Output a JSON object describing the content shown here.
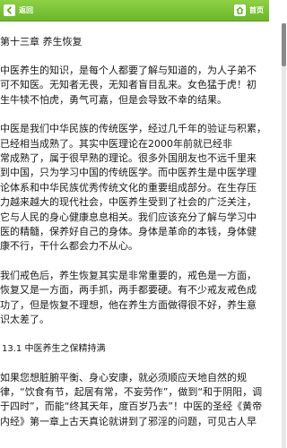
{
  "toolbar": {
    "back_label": "返回",
    "home_label": "首页",
    "back_icon": "back-arrow-icon",
    "home_icon": "home-icon",
    "bar_color": "#7cc337"
  },
  "chapter": {
    "title": "第十三章 养生恢复",
    "paragraphs": [
      [
        "中医养生的知识，是每个人都要了解与知道的，为人子弟不",
        "可不知医。无知者无畏，无知者盲目乱来。女色猛于虎！初",
        "生牛犊不怕虎，勇气可嘉，但是会导致不幸的结果。"
      ],
      [
        "中医是我们中华民族的传统医学，经过几千年的验证与积累，",
        "已经相当成熟了。其实中医理论在2000年前就已经非",
        "常成熟了，属于很早熟的理论。很多外国朋友也不远千里来",
        "到中国，只为学习中国的传统医学。而中医养生是中医学理",
        "论体系和中华民族优秀传统文化的重要组成部分。在生存压",
        "力越来越大的现代社会，中医养生受到了社会的广泛关注，",
        "它与人民的身心健康息息相关。我们应该充分了解与学习中",
        "医的精髓，保养好自己的身体。身体是革命的本钱，身体健",
        "康不行，干什么都会力不从心。"
      ],
      [
        "我们戒色后，养生恢复其实是非常重要的，戒色是一方面，",
        "恢复又是一方面，两手抓，两手都要硬。有不少戒友戒色成",
        "功了，但是恢复不理想，他在养生方面做得很不好，养生意",
        "识太差了。"
      ]
    ],
    "section_heading": "13.1 中医养生之保精持满",
    "section_paragraph": [
      "如果您想脏腑平衡、身心安康，就必须顺应天地自然的规",
      "律，“饮食有节，起居有常，不妄劳作”，做到“和于阴阳，调",
      "于四时”，而能“终其天年，度百岁乃去”！中医的圣经《黄帝",
      "内经》第一章上古天真论就讲到了邪淫的问题，可见古人早"
    ]
  }
}
